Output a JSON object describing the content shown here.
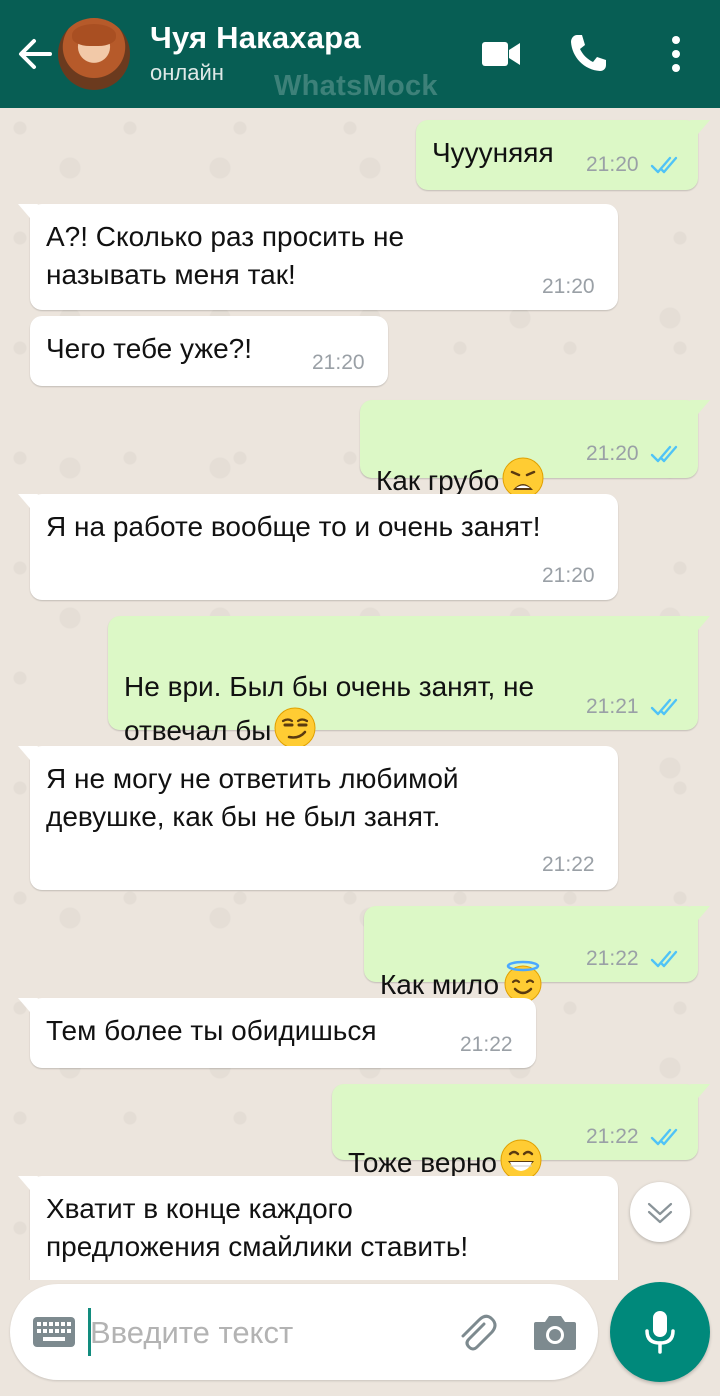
{
  "header": {
    "contact_name": "Чуя Накахара",
    "status": "онлайн",
    "watermark": "WhatsMock"
  },
  "messages": [
    {
      "direction": "out",
      "text": "Чуууняяя",
      "time": "21:20",
      "read": true
    },
    {
      "direction": "in",
      "text": "А?! Сколько раз просить не\nназывать меня так!",
      "time": "21:20"
    },
    {
      "direction": "in",
      "text": "Чего тебе уже?!",
      "time": "21:20"
    },
    {
      "direction": "out",
      "text": "Как грубо",
      "emoji": "weary-face",
      "time": "21:20",
      "read": true
    },
    {
      "direction": "in",
      "text": "Я на работе вообще то и очень занят!",
      "time": "21:20"
    },
    {
      "direction": "out",
      "text": "Не ври. Был бы очень занят, не\nотвечал бы",
      "emoji": "smirking-face",
      "time": "21:21",
      "read": true
    },
    {
      "direction": "in",
      "text": "Я не могу не ответить любимой\nдевушке, как бы не был занят.",
      "time": "21:22"
    },
    {
      "direction": "out",
      "text": "Как мило",
      "emoji": "halo-face",
      "time": "21:22",
      "read": true
    },
    {
      "direction": "in",
      "text": "Тем более ты обидишься",
      "time": "21:22"
    },
    {
      "direction": "out",
      "text": "Тоже верно",
      "emoji": "grinning-face",
      "time": "21:22",
      "read": true
    },
    {
      "direction": "in",
      "text": "Хватит в конце каждого\nпредложения смайлики ставить!",
      "time": ""
    }
  ],
  "input": {
    "placeholder": "Введите текст"
  },
  "colors": {
    "header": "#075e54",
    "outgoing_bubble": "#dcf8c6",
    "incoming_bubble": "#ffffff",
    "read_ticks": "#4fc3f7",
    "mic_button": "#00897b"
  }
}
